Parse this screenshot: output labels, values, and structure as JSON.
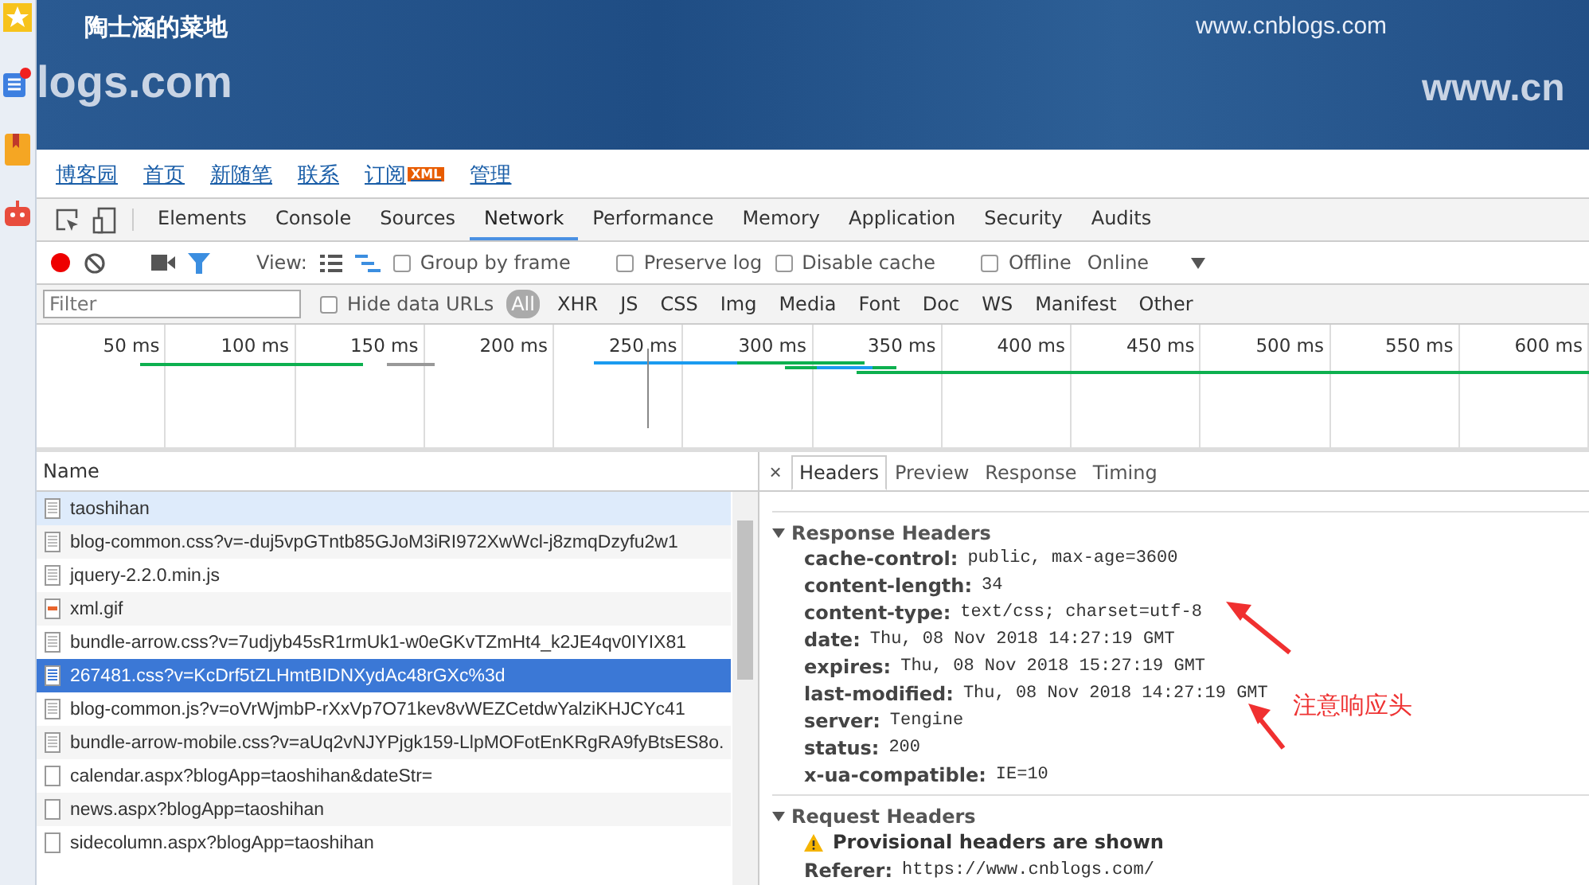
{
  "banner": {
    "title": "陶士涵的菜地",
    "site": "www.cnblogs.com",
    "watermark_left": "logs.com",
    "watermark_right": "www.cn"
  },
  "nav": [
    {
      "label": "博客园"
    },
    {
      "label": "首页"
    },
    {
      "label": "新随笔"
    },
    {
      "label": "联系"
    },
    {
      "label": "订阅",
      "badge": "XML"
    },
    {
      "label": "管理"
    }
  ],
  "devtools": {
    "tabs": [
      {
        "label": "Elements",
        "selected": false
      },
      {
        "label": "Console",
        "selected": false
      },
      {
        "label": "Sources",
        "selected": false
      },
      {
        "label": "Network",
        "selected": true
      },
      {
        "label": "Performance",
        "selected": false
      },
      {
        "label": "Memory",
        "selected": false
      },
      {
        "label": "Application",
        "selected": false
      },
      {
        "label": "Security",
        "selected": false
      },
      {
        "label": "Audits",
        "selected": false
      }
    ],
    "toolbar": {
      "recording": true,
      "filter_on": true,
      "view_label": "View:",
      "options": [
        {
          "label": "Group by frame",
          "checked": false
        },
        {
          "label": "Preserve log",
          "checked": false
        },
        {
          "label": "Disable cache",
          "checked": false
        },
        {
          "label": "Offline",
          "checked": false
        }
      ],
      "throttle": "Online"
    },
    "filter": {
      "placeholder": "Filter",
      "hide_data_urls": {
        "label": "Hide data URLs",
        "checked": false
      },
      "types": [
        {
          "label": "All",
          "selected": true
        },
        {
          "label": "XHR",
          "selected": false
        },
        {
          "label": "JS",
          "selected": false
        },
        {
          "label": "CSS",
          "selected": false
        },
        {
          "label": "Img",
          "selected": false
        },
        {
          "label": "Media",
          "selected": false
        },
        {
          "label": "Font",
          "selected": false
        },
        {
          "label": "Doc",
          "selected": false
        },
        {
          "label": "WS",
          "selected": false
        },
        {
          "label": "Manifest",
          "selected": false
        },
        {
          "label": "Other",
          "selected": false
        }
      ]
    },
    "timeline_ticks": [
      "50 ms",
      "100 ms",
      "150 ms",
      "200 ms",
      "250 ms",
      "300 ms",
      "350 ms",
      "400 ms",
      "450 ms",
      "500 ms",
      "550 ms",
      "600 ms"
    ],
    "requests": {
      "column": "Name",
      "rows": [
        {
          "name": "taoshihan",
          "kind": "document",
          "selected": false,
          "hovered": true
        },
        {
          "name": "blog-common.css?v=-duj5vpGTntb85GJoM3iRI972XwWcl-j8zmqDzyfu2w1",
          "kind": "document",
          "selected": false,
          "hovered": false
        },
        {
          "name": "jquery-2.2.0.min.js",
          "kind": "document",
          "selected": false,
          "hovered": false
        },
        {
          "name": "xml.gif",
          "kind": "image",
          "selected": false,
          "hovered": false
        },
        {
          "name": "bundle-arrow.css?v=7udjyb45sR1rmUk1-w0eGKvTZmHt4_k2JE4qv0IYIX81",
          "kind": "document",
          "selected": false,
          "hovered": false
        },
        {
          "name": "267481.css?v=KcDrf5tZLHmtBIDNXydAc48rGXc%3d",
          "kind": "document",
          "selected": true,
          "hovered": false
        },
        {
          "name": "blog-common.js?v=oVrWjmbP-rXxVp7O71kev8vWEZCetdwYalziKHJCYc41",
          "kind": "document",
          "selected": false,
          "hovered": false
        },
        {
          "name": "bundle-arrow-mobile.css?v=aUq2vNJYPjgk159-LlpMOFotEnKRgRA9fyBtsES8o.",
          "kind": "document",
          "selected": false,
          "hovered": false
        },
        {
          "name": "calendar.aspx?blogApp=taoshihan&dateStr=",
          "kind": "blank",
          "selected": false,
          "hovered": false
        },
        {
          "name": "news.aspx?blogApp=taoshihan",
          "kind": "blank",
          "selected": false,
          "hovered": false
        },
        {
          "name": "sidecolumn.aspx?blogApp=taoshihan",
          "kind": "blank",
          "selected": false,
          "hovered": false
        }
      ]
    },
    "detail": {
      "close": "×",
      "tabs": [
        {
          "label": "Headers",
          "selected": true
        },
        {
          "label": "Preview",
          "selected": false
        },
        {
          "label": "Response",
          "selected": false
        },
        {
          "label": "Timing",
          "selected": false
        }
      ],
      "sections": [
        {
          "title": "Response Headers",
          "expanded": true,
          "headers": [
            {
              "key": "cache-control:",
              "value": "public, max-age=3600"
            },
            {
              "key": "content-length:",
              "value": "34"
            },
            {
              "key": "content-type:",
              "value": "text/css; charset=utf-8"
            },
            {
              "key": "date:",
              "value": "Thu, 08 Nov 2018 14:27:19 GMT"
            },
            {
              "key": "expires:",
              "value": "Thu, 08 Nov 2018 15:27:19 GMT"
            },
            {
              "key": "last-modified:",
              "value": "Thu, 08 Nov 2018 14:27:19 GMT"
            },
            {
              "key": "server:",
              "value": "Tengine"
            },
            {
              "key": "status:",
              "value": "200"
            },
            {
              "key": "x-ua-compatible:",
              "value": "IE=10"
            }
          ]
        },
        {
          "title": "Request Headers",
          "expanded": true,
          "warning": "Provisional headers are shown",
          "headers": [
            {
              "key": "Referer:",
              "value": "https://www.cnblogs.com/"
            }
          ]
        }
      ]
    }
  },
  "annotation": {
    "text": "注意响应头"
  }
}
